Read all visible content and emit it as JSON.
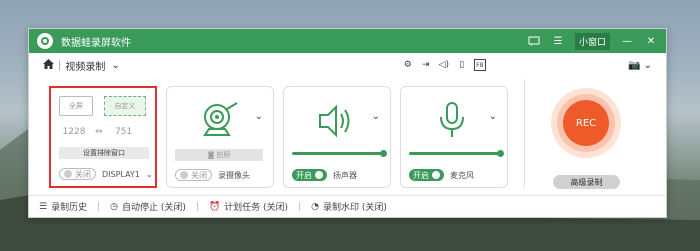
{
  "app": {
    "title": "数据蛙录屏软件",
    "mini_window": "小窗口"
  },
  "toolbar": {
    "mode_label": "视频录制"
  },
  "screen_panel": {
    "fullscreen_label": "全屏",
    "custom_label": "自定义",
    "width": "1228",
    "height": "751",
    "exclude_window_label": "设置排除窗口",
    "toggle_label": "关闭",
    "display_label": "DISPLAY1"
  },
  "camera_panel": {
    "photo_label": "拍照",
    "toggle_label": "关闭",
    "name": "录摄像头"
  },
  "speaker_panel": {
    "toggle_label": "开启",
    "name": "扬声器",
    "volume": 1.0
  },
  "mic_panel": {
    "toggle_label": "开启",
    "name": "麦克风",
    "volume": 1.0
  },
  "rec": {
    "label": "REC",
    "advanced_label": "高级录制"
  },
  "statusbar": {
    "history": "录制历史",
    "auto_stop": "自动停止 (关闭)",
    "schedule": "计划任务 (关闭)",
    "watermark": "录制水印 (关闭)"
  },
  "colors": {
    "brand_green": "#3a9a5a",
    "rec_orange": "#ef5a2a",
    "selection_red": "#e03030"
  }
}
